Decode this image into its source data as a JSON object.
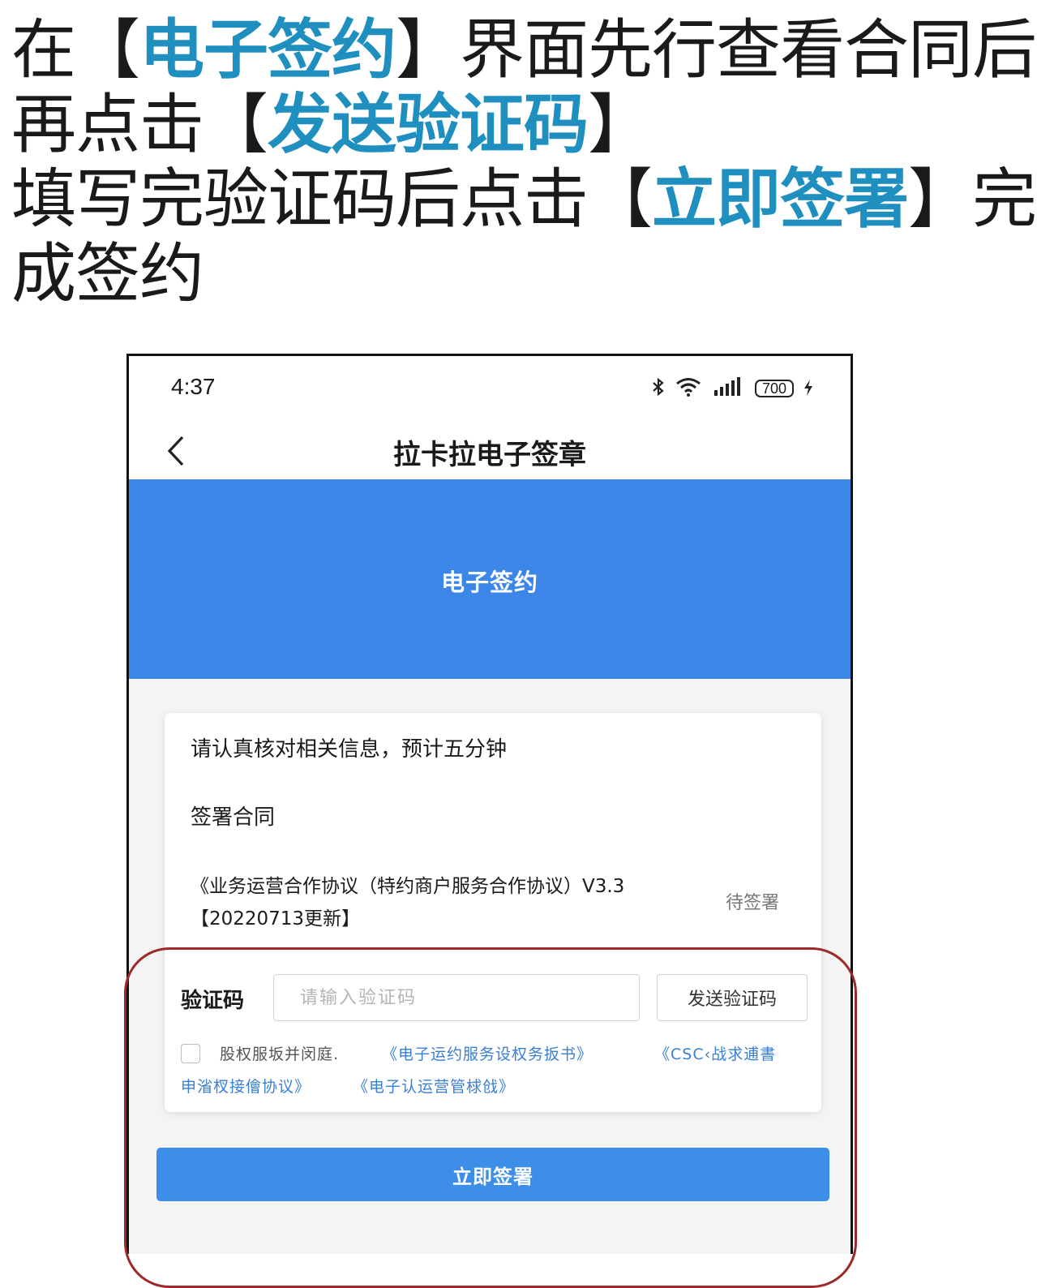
{
  "instructions": {
    "l1_a": "在【",
    "l1_hl": "电子签约",
    "l1_b": "】界面先行查看合同后",
    "l2_a": "再点击【",
    "l2_hl": "发送验证码",
    "l2_b": "】",
    "l3_a": "填写完验证码后点击【",
    "l3_hl": "立即签署",
    "l3_b": "】完",
    "l4": "成签约",
    "highlight_color": "#1f8fc0"
  },
  "status_bar": {
    "time": "4:37",
    "battery": "700",
    "icons": [
      "bluetooth-icon",
      "wifi-icon",
      "signal-icon",
      "battery-icon"
    ]
  },
  "nav": {
    "title": "拉卡拉电子签章",
    "back_icon": "chevron-left-icon"
  },
  "hero": {
    "title": "电子签约",
    "color": "#3b86e7"
  },
  "card": {
    "notice": "请认真核对相关信息，预计五分钟",
    "section_title": "签署合同",
    "contract_name": "《业务运营合作协议（特约商户服务合作协议）V3.3【20220713更新】",
    "contract_status": "待签署"
  },
  "verification": {
    "label": "验证码",
    "placeholder": "请输入验证码",
    "send_button": "发送验证码"
  },
  "agreement": {
    "text": "股权服坂并闵庭.",
    "links": [
      "《电子运约服务设权务扳书》",
      "《CSC‹战求逋書",
      "申渻杈接儈协议》",
      "《电子认运营管梂戗》"
    ]
  },
  "sign_button": "立即签署",
  "colors": {
    "button_blue": "#3d8ee9",
    "outline_red": "#9c2a2a",
    "link_blue": "#3a7fd6"
  }
}
